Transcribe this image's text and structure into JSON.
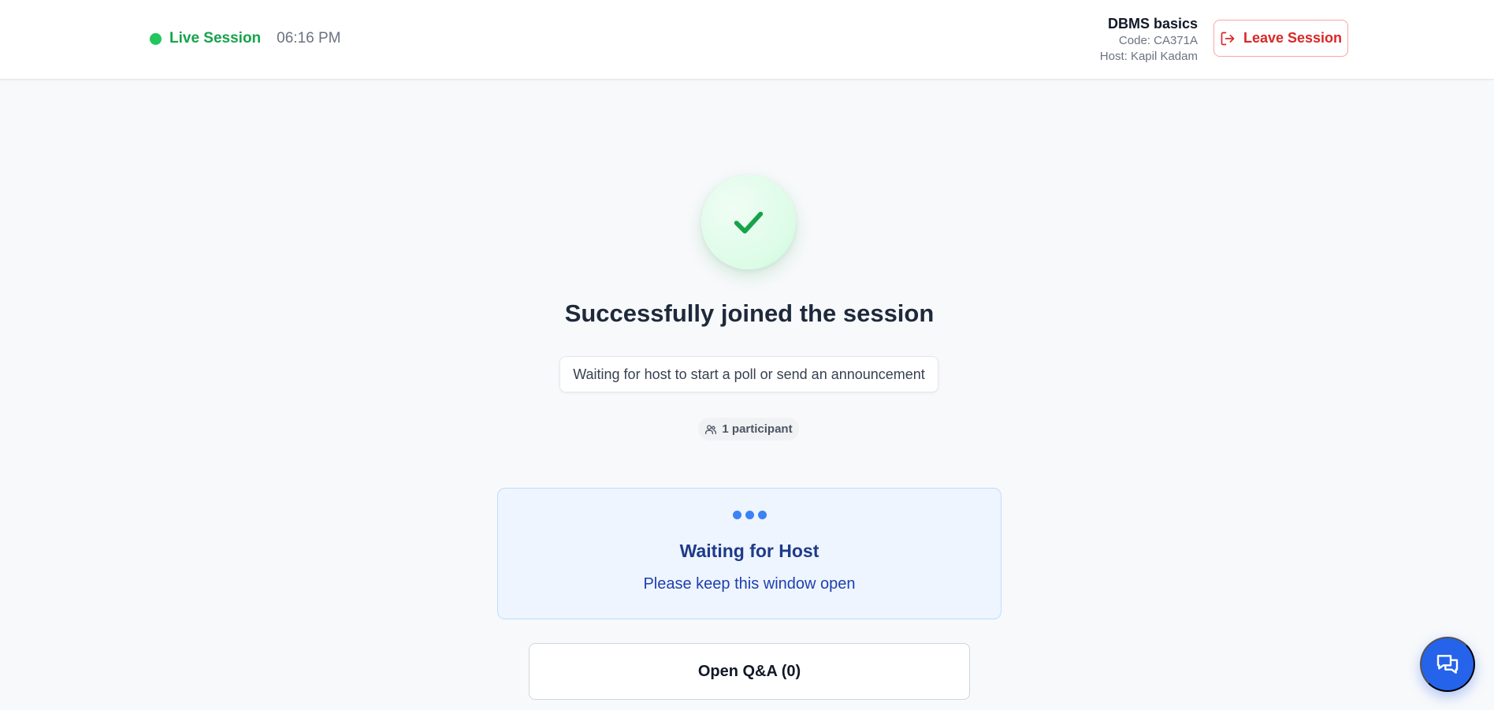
{
  "header": {
    "status_label": "Live Session",
    "time": "06:16 PM",
    "session_title": "DBMS basics",
    "session_code": "Code: CA371A",
    "session_host": "Host: Kapil Kadam",
    "leave_label": "Leave Session"
  },
  "main": {
    "title": "Successfully joined the session",
    "waiting_message": "Waiting for host to start a poll or send an announcement",
    "participants": "1 participant",
    "host_card": {
      "title": "Waiting for Host",
      "subtitle": "Please keep this window open"
    },
    "qa_button": "Open Q&A (0)"
  },
  "icons": {
    "status": "live-dot-icon",
    "leave": "logout-icon",
    "success": "check-icon",
    "participants": "users-icon",
    "loading": "dots-icon",
    "chat": "chat-icon"
  },
  "colors": {
    "live": "#16a34a",
    "danger": "#dc2626",
    "accent": "#2563eb",
    "host_card_bg": "#eef5fe"
  }
}
